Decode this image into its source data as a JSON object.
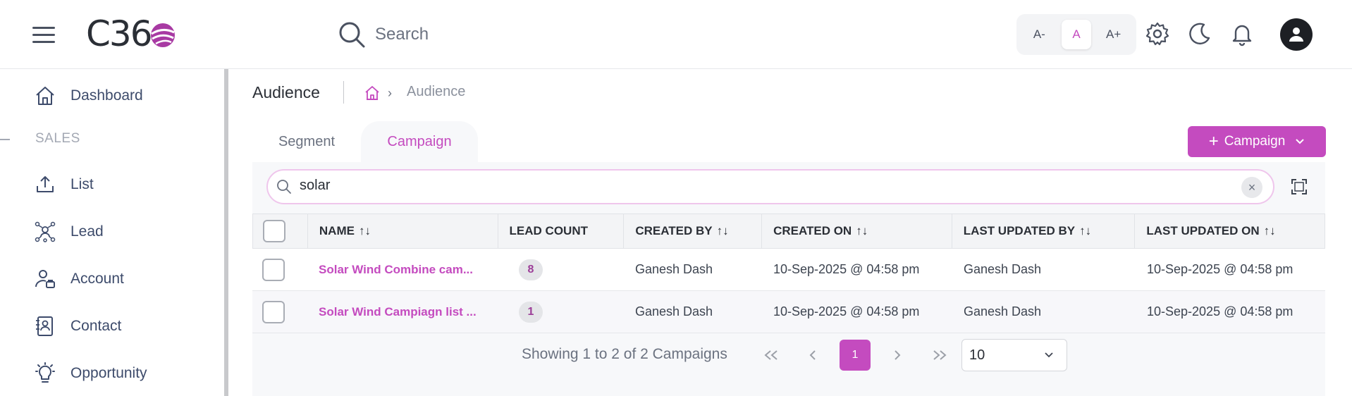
{
  "app": {
    "logo_text": "C36"
  },
  "header": {
    "search_placeholder": "Search",
    "font_sizes": [
      "A-",
      "A",
      "A+"
    ]
  },
  "sidebar": {
    "section_label": "SALES",
    "items": [
      {
        "label": "Dashboard",
        "icon": "home-icon"
      },
      {
        "label": "List",
        "icon": "upload-icon"
      },
      {
        "label": "Lead",
        "icon": "network-icon"
      },
      {
        "label": "Account",
        "icon": "user-card-icon"
      },
      {
        "label": "Contact",
        "icon": "contact-book-icon"
      },
      {
        "label": "Opportunity",
        "icon": "lightbulb-icon"
      }
    ]
  },
  "page": {
    "title": "Audience",
    "breadcrumb_current": "Audience",
    "tabs": [
      "Segment",
      "Campaign"
    ],
    "campaign_button": "Campaign",
    "filter_value": "solar"
  },
  "table": {
    "headers": [
      "NAME",
      "LEAD COUNT",
      "CREATED BY",
      "CREATED ON",
      "LAST UPDATED BY",
      "LAST UPDATED ON"
    ],
    "sort_glyph": "↑↓",
    "rows": [
      {
        "name": "Solar Wind Combine cam...",
        "lead_count": "8",
        "created_by": "Ganesh Dash",
        "created_on": "10-Sep-2025 @ 04:58 pm",
        "updated_by": "Ganesh Dash",
        "updated_on": "10-Sep-2025 @ 04:58 pm"
      },
      {
        "name": "Solar Wind Campiagn list ...",
        "lead_count": "1",
        "created_by": "Ganesh Dash",
        "created_on": "10-Sep-2025 @ 04:58 pm",
        "updated_by": "Ganesh Dash",
        "updated_on": "10-Sep-2025 @ 04:58 pm"
      }
    ]
  },
  "pagination": {
    "summary": "Showing 1 to 2 of 2 Campaigns",
    "current_page": "1",
    "per_page": "10"
  },
  "colors": {
    "accent": "#c44bbf"
  }
}
